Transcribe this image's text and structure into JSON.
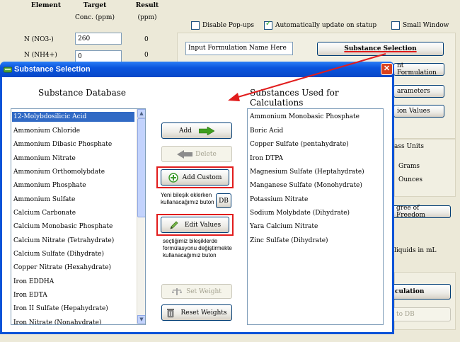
{
  "main": {
    "columns": {
      "element": "Element",
      "target": "Target",
      "target_unit": "Conc. (ppm)",
      "result": "Result",
      "result_unit": "(ppm)"
    },
    "rows": [
      {
        "element": "N (NO3-)",
        "target": "260",
        "result": "0"
      },
      {
        "element": "N (NH4+)",
        "target": "0",
        "result": "0"
      }
    ],
    "checkboxes": {
      "disable_popups": "Disable Pop-ups",
      "auto_update": "Automatically update on statup",
      "small_window": "Small Window"
    },
    "formulation_name_placeholder": "Input Formulation Name Here",
    "substance_selection_button": "Substance Selection",
    "partial_labels": {
      "formulation_btn": "nt Formulation",
      "parameters_btn": "arameters",
      "values_btn": "ion Values",
      "mass_units": "ass Units",
      "grams": "Grams",
      "ounces": "Ounces",
      "degree_btn": "gree of Freedom",
      "liquids": "liquids in mL",
      "calculation_btn": "culation",
      "to_db_btn": "to DB"
    }
  },
  "dialog": {
    "title": "Substance Selection",
    "database_heading": "Substance Database",
    "used_heading": "Substances Used for Calculations",
    "database_items": [
      "12-Molybdosilicic Acid",
      "Ammonium Chloride",
      "Ammonium Dibasic Phosphate",
      "Ammonium Nitrate",
      "Ammonium Orthomolybdate",
      "Ammonium Phosphate",
      "Ammonium Sulfate",
      "Calcium Carbonate",
      "Calcium Monobasic Phosphate",
      "Calcium Nitrate (Tetrahydrate)",
      "Calcium Sulfate (Dihydrate)",
      "Copper Nitrate (Hexahydrate)",
      "Iron EDDHA",
      "Iron EDTA",
      "Iron II Sulfate (Hepahydrate)",
      "Iron Nitrate (Nonahydrate)"
    ],
    "used_items": [
      "Ammonium Monobasic Phosphate",
      "Boric Acid",
      "Copper Sulfate (pentahydrate)",
      "Iron DTPA",
      "Magnesium Sulfate (Heptahydrate)",
      "Manganese Sulfate (Monohydrate)",
      "Potassium Nitrate",
      "Sodium Molybdate (Dihydrate)",
      "Yara Calcium Nitrate",
      "Zinc Sulfate (Dihydrate)"
    ],
    "buttons": {
      "add": "Add",
      "delete": "Delete",
      "add_custom": "Add Custom",
      "db": "DB",
      "edit_values": "Edit Values",
      "set_weight": "Set Weight",
      "reset_weights": "Reset Weights"
    },
    "notes": {
      "add_custom_note": "Yeni bileşik eklerken\nkullanacağımız buton",
      "edit_values_note": "seçtiğimiz bileşiklerde\nformülasyonu değiştirmekte\nkullanacağımız buton"
    }
  },
  "colors": {
    "xp_blue": "#0a53d8",
    "selection": "#316ac5",
    "annotation_red": "#e11c1c",
    "arrow_green": "#3f9e1f"
  }
}
